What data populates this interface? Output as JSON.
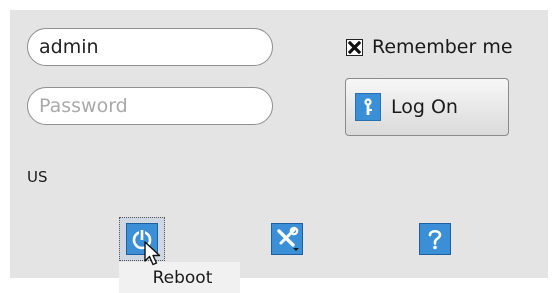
{
  "login": {
    "username_value": "admin",
    "password_placeholder": "Password",
    "password_value": ""
  },
  "remember": {
    "label": "Remember me",
    "checked": true
  },
  "logon_button": {
    "label": "Log On",
    "icon": "key-icon"
  },
  "domain": {
    "label": "US"
  },
  "toolbar": {
    "buttons": [
      {
        "icon": "power-icon",
        "tooltip": "Reboot"
      },
      {
        "icon": "tools-icon"
      },
      {
        "icon": "help-icon"
      }
    ]
  },
  "tooltip": {
    "text": "Reboot"
  },
  "colors": {
    "background": "#e4e4e4",
    "accent_blue": "#3b8fd6"
  }
}
